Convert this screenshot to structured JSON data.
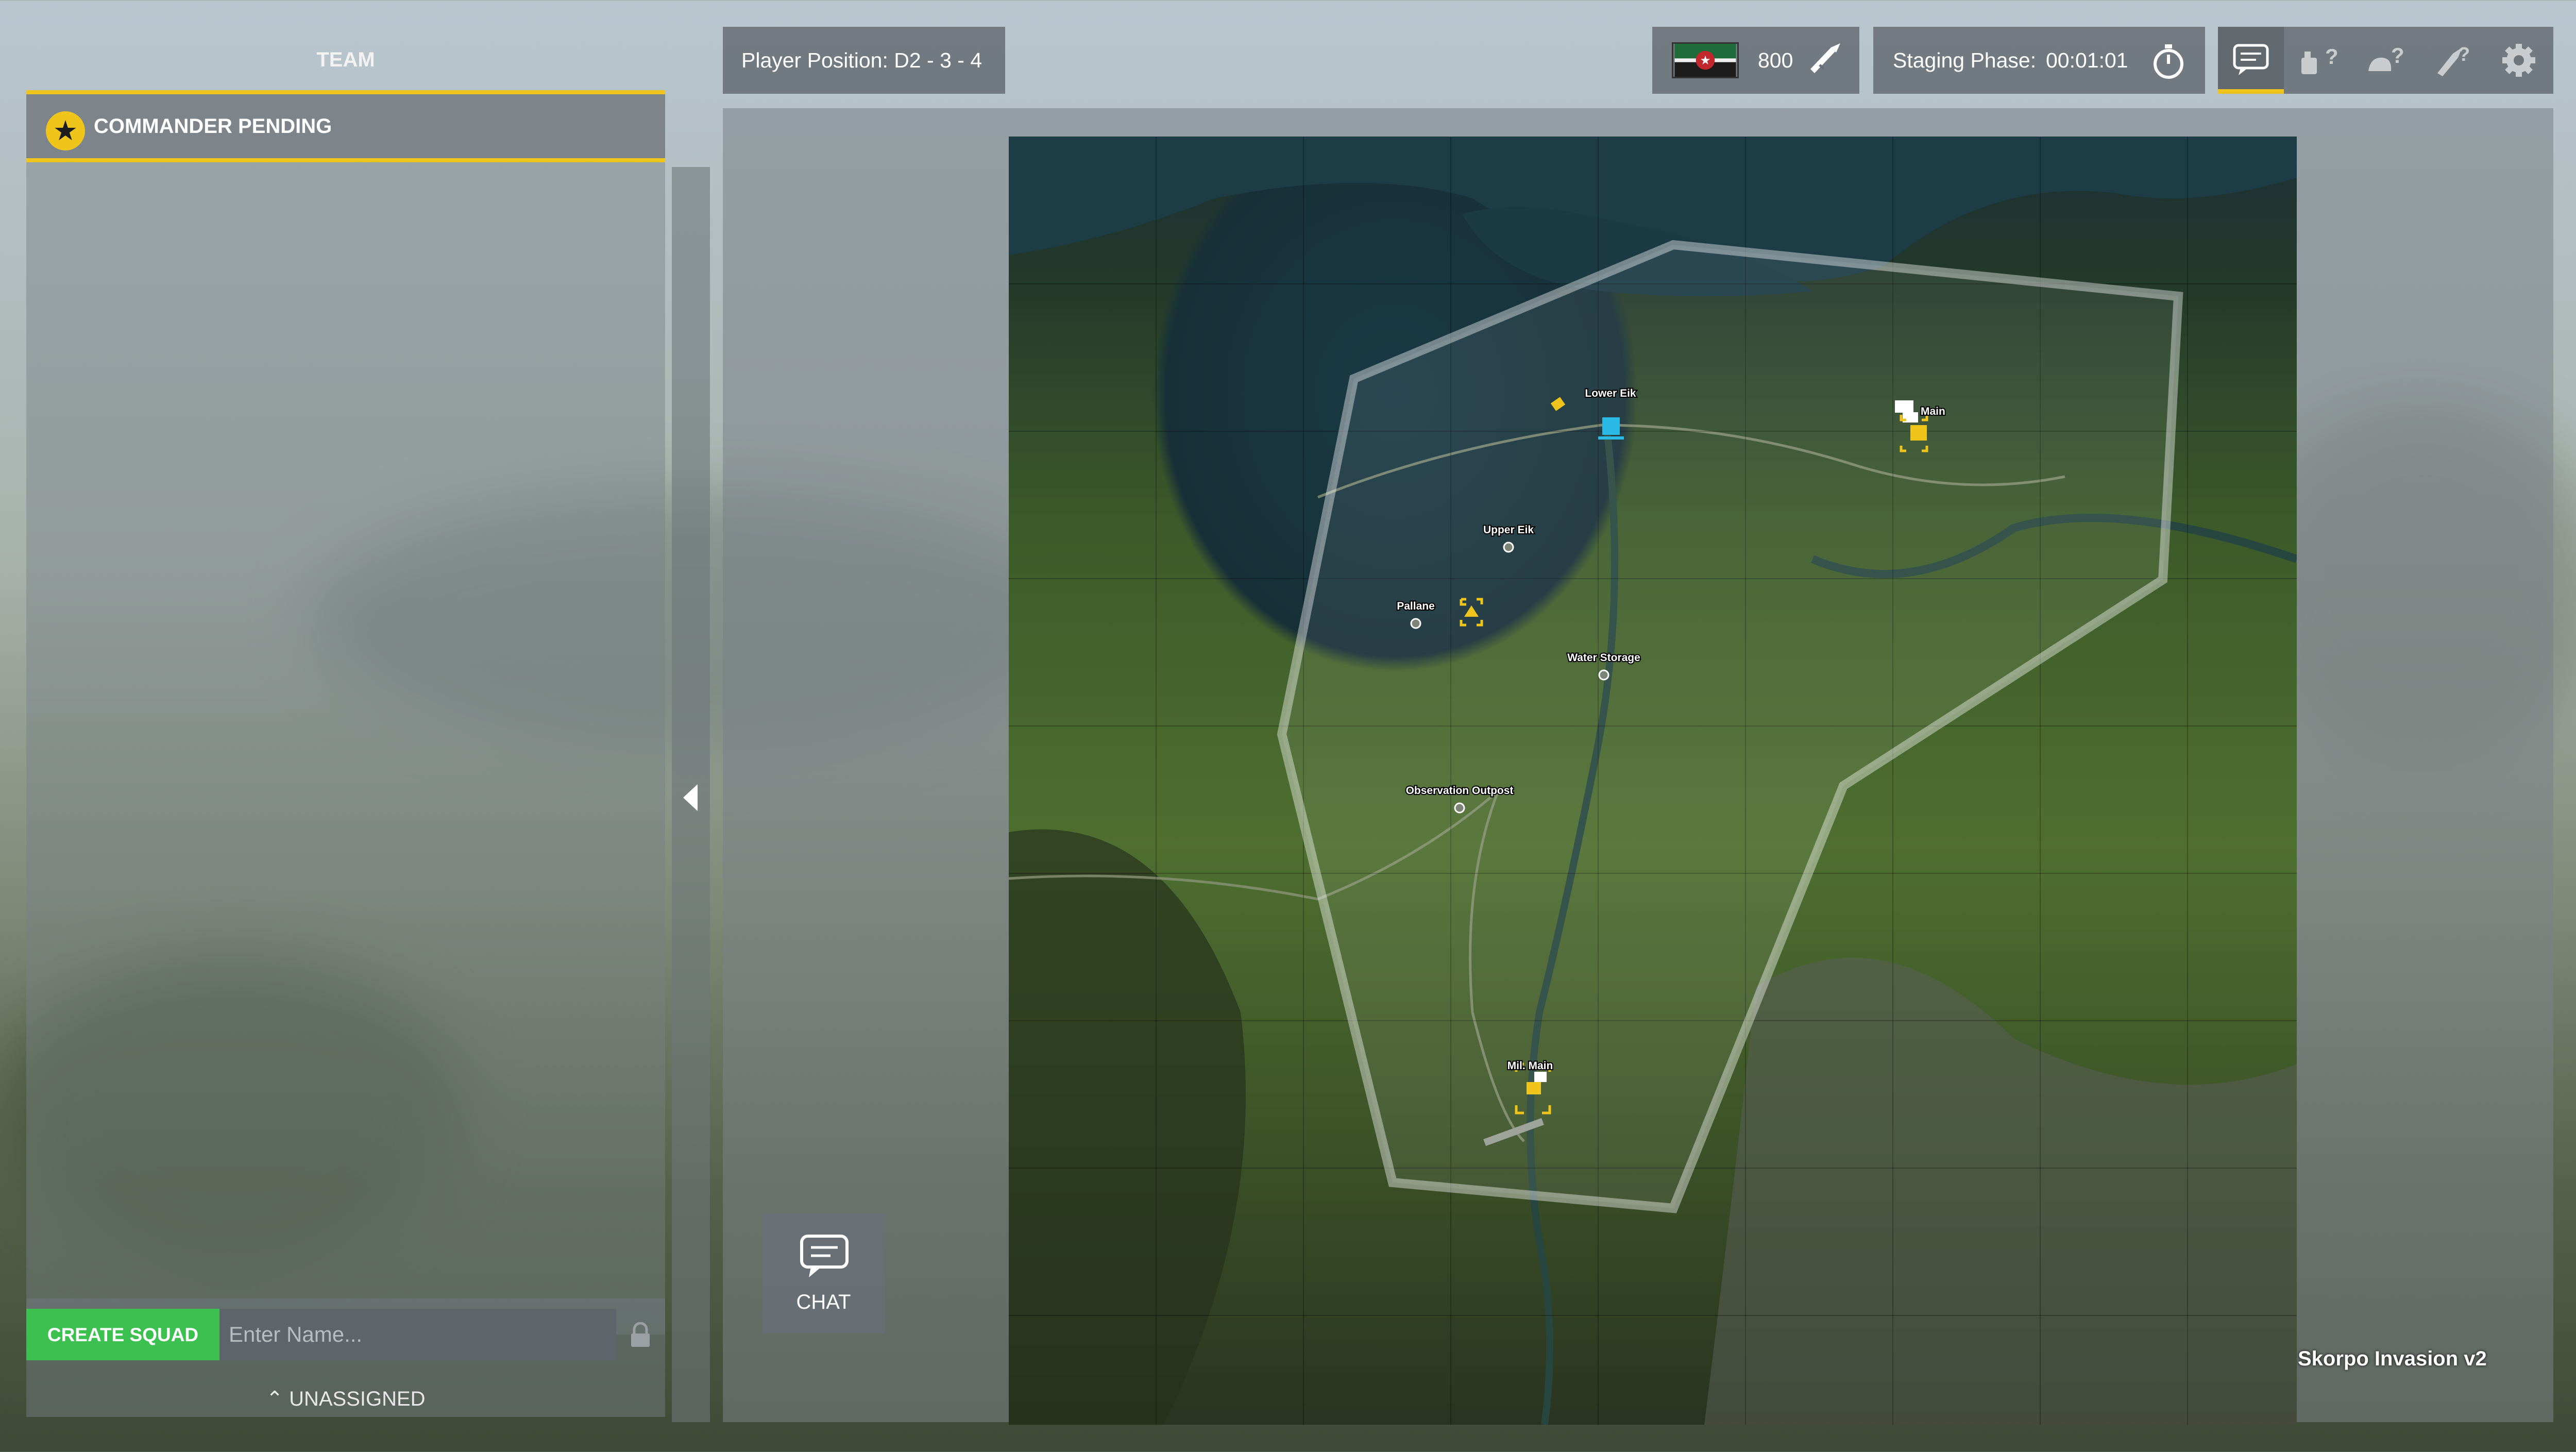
{
  "team_panel": {
    "title": "TEAM",
    "commander_label": "COMMANDER PENDING",
    "commander_icon": "star-icon",
    "create_squad_label": "CREATE SQUAD",
    "squad_name_placeholder": "Enter Name...",
    "lock_icon": "lock-icon",
    "unassigned_label": "UNASSIGNED",
    "unassigned_icon": "chevron-up-icon"
  },
  "top_bar": {
    "player_position": "Player Position: D2 - 3 - 4",
    "tickets": "800",
    "ticket_icon": "ticket-icon",
    "phase_label": "Staging Phase:",
    "phase_time": "00:01:01",
    "phase_icon": "stopwatch-icon",
    "menu_icons": [
      "chat-icon",
      "vehicle-help-icon",
      "helmet-help-icon",
      "deploy-help-icon",
      "gear-icon"
    ]
  },
  "chat_button": {
    "label": "CHAT",
    "icon": "chat-bubble-icon"
  },
  "map": {
    "name": "Skorpo Invasion v2",
    "locations": [
      "Lower Eik",
      "Main",
      "Upper Eik",
      "Pallane",
      "Water Storage",
      "Observation Outpost",
      "Mil. Main"
    ]
  },
  "colors": {
    "accent": "#f0c51b",
    "create_squad": "#3cc04f",
    "panel": "#6f767b"
  }
}
